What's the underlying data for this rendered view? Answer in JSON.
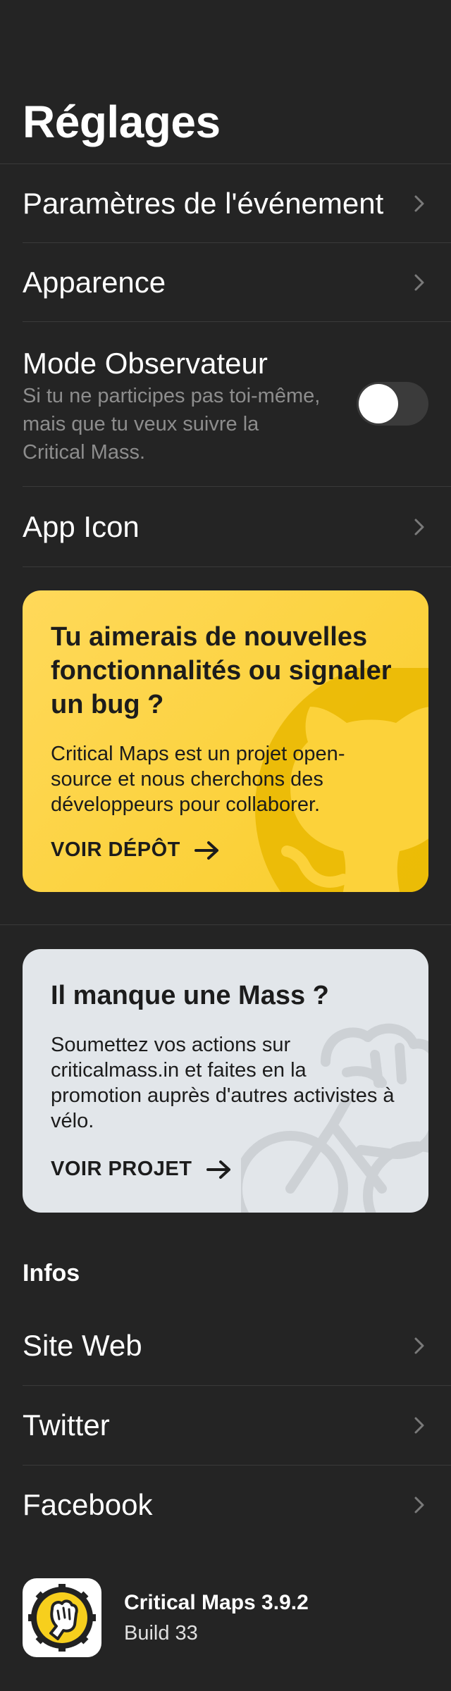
{
  "header": {
    "title": "Réglages"
  },
  "settings": {
    "event_settings": "Paramètres de l'événement",
    "appearance": "Apparence",
    "observer": {
      "label": "Mode Observateur",
      "description": "Si tu ne participes pas toi-même, mais que tu veux suivre la Critical Mass.",
      "enabled": false
    },
    "app_icon": "App Icon"
  },
  "cards": {
    "github": {
      "title": "Tu aimerais de nouvelles fonctionnalités ou signaler un bug ?",
      "body": "Critical Maps est un projet open-source et nous cherchons des développeurs pour collaborer.",
      "link": "VOIR DÉPÔT",
      "icon": "github-octocat-icon",
      "color": "#ffd84f"
    },
    "mass": {
      "title": "Il manque une Mass ?",
      "body": "Soumettez vos actions sur criticalmass.in et faites en la promotion auprès d'autres activistes à vélo.",
      "link": "VOIR PROJET",
      "icon": "fist-bike-icon",
      "color": "#e2e6ea"
    }
  },
  "info": {
    "header": "Infos",
    "items": [
      {
        "label": "Site Web"
      },
      {
        "label": "Twitter"
      },
      {
        "label": "Facebook"
      }
    ]
  },
  "app": {
    "name": "Critical Maps 3.9.2",
    "build": "Build 33",
    "icon": "critical-maps-logo-icon"
  }
}
